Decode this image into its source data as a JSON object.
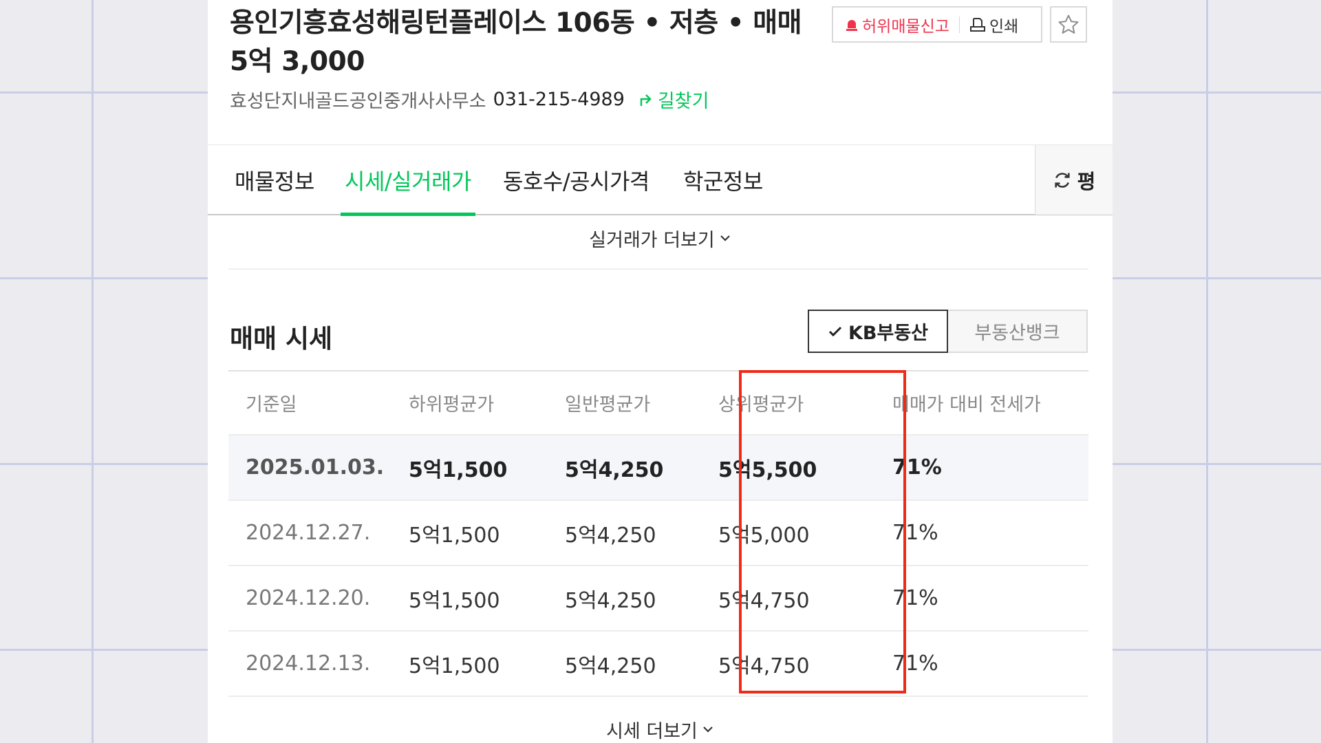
{
  "listing": {
    "title_line1": "용인기흥효성해링턴플레이스 106동 • 저층 • 매매",
    "title_line2": "5억 3,000",
    "agency": "효성단지내골드공인중개사사무소",
    "phone": "031-215-4989",
    "directions_label": "길찾기"
  },
  "actions": {
    "report_label": "허위매물신고",
    "print_label": "인쇄"
  },
  "tabs": [
    {
      "label": "매물정보"
    },
    {
      "label": "시세/실거래가"
    },
    {
      "label": "동호수/공시가격"
    },
    {
      "label": "학군정보"
    }
  ],
  "unit_toggle_label": "평",
  "real_price_more_label": "실거래가 더보기",
  "section": {
    "title": "매매 시세",
    "sources": [
      {
        "label": "KB부동산",
        "selected": true
      },
      {
        "label": "부동산뱅크",
        "selected": false
      }
    ]
  },
  "table": {
    "headers": [
      "기준일",
      "하위평균가",
      "일반평균가",
      "상위평균가",
      "매매가 대비 전세가"
    ],
    "rows": [
      [
        "2025.01.03.",
        "5억1,500",
        "5억4,250",
        "5억5,500",
        "71%"
      ],
      [
        "2024.12.27.",
        "5억1,500",
        "5억4,250",
        "5억5,000",
        "71%"
      ],
      [
        "2024.12.20.",
        "5억1,500",
        "5억4,250",
        "5억4,750",
        "71%"
      ],
      [
        "2024.12.13.",
        "5억1,500",
        "5억4,250",
        "5억4,750",
        "71%"
      ]
    ]
  },
  "price_more_label": "시세 더보기",
  "colors": {
    "accent_green": "#03c75a",
    "report_red": "#f0334d",
    "highlight_red": "#ef2a17"
  }
}
